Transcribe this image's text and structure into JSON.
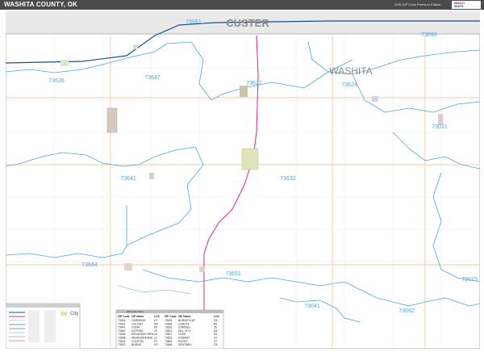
{
  "title": "WASHITA COUNTY, OK",
  "edition": "2020 ZIP Code Premium Edition",
  "logo": {
    "line1": "Market",
    "line2": "MAPS"
  },
  "counties": {
    "north": "CUSTER",
    "main": "WASHITA"
  },
  "zip_labels": [
    "73661",
    "73096",
    "73626",
    "73647",
    "73622",
    "73624",
    "73021",
    "73641",
    "73632",
    "73664",
    "73651",
    "73015",
    "73041",
    "73062"
  ],
  "legend": {
    "city_label": "City"
  },
  "index": {
    "title": "ZIP Code Index",
    "headers": [
      "ZIP Code",
      "ZIP Name",
      "LOC",
      "ZIP Code",
      "ZIP Name",
      "LOC"
    ],
    "rows": [
      [
        "73015",
        "CARNEGIE",
        "H7",
        "73624",
        "BURNS FLAT",
        "D3"
      ],
      [
        "73021",
        "COLONY",
        "M3",
        "73626",
        "CANUTE",
        "B3"
      ],
      [
        "73041",
        "COHN",
        "K9",
        "73632",
        "CORDELL",
        "J5"
      ],
      [
        "73062",
        "GOTEBO",
        "J9",
        "73641",
        "DILL CITY",
        "D6"
      ],
      [
        "73096",
        "MOUNTAIN VIEW",
        "L6",
        "73647",
        "FOSS",
        "E3"
      ],
      [
        "73098",
        "WEATHERFORD",
        "L2",
        "73651",
        "HOBART",
        "G7"
      ],
      [
        "73601",
        "CLINTON",
        "F1",
        "73661",
        "ROCKY",
        "G7"
      ],
      [
        "73622",
        "BURNS",
        "H2",
        "73664",
        "SENTINEL",
        "C8"
      ]
    ]
  },
  "colors": {
    "boundary": "#4da6dd",
    "interstate": "#1b4f8a",
    "highway": "#e6348f",
    "road": "#f2c9a0",
    "county_line": "#9a9a9a",
    "title_bar": "#4a4a4a"
  }
}
